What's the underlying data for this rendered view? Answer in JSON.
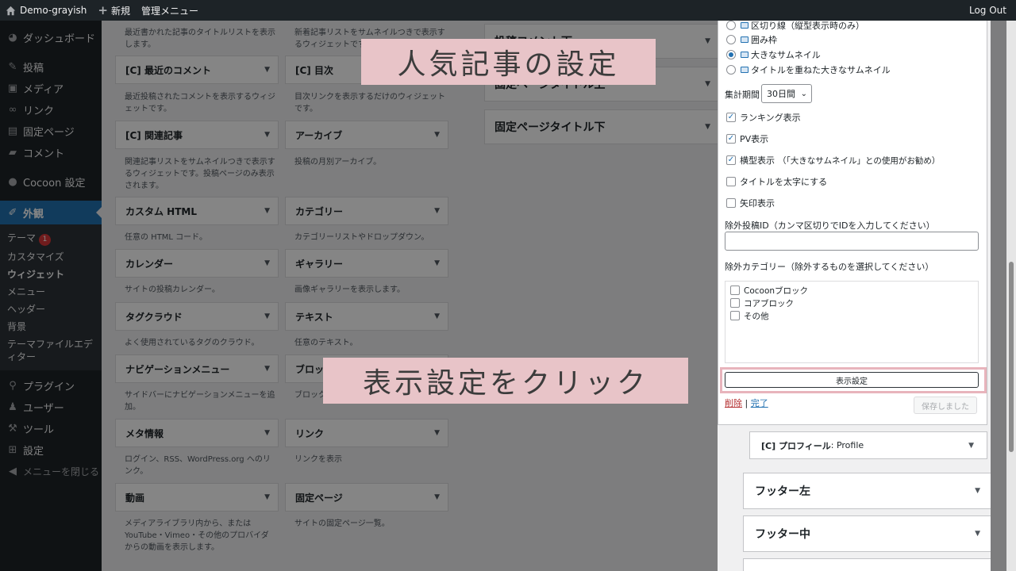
{
  "adminbar": {
    "site_name": "Demo-grayish",
    "new_label": "新規",
    "manage_menu": "管理メニュー",
    "logout": "Log Out"
  },
  "sidebar": {
    "items": [
      {
        "icon": "dashboard-icon",
        "label": "ダッシュボード"
      },
      {
        "icon": "pin-icon",
        "label": "投稿"
      },
      {
        "icon": "media-icon",
        "label": "メディア"
      },
      {
        "icon": "link-icon",
        "label": "リンク"
      },
      {
        "icon": "page-icon",
        "label": "固定ページ"
      },
      {
        "icon": "comment-icon",
        "label": "コメント"
      },
      {
        "icon": "cocoon-icon",
        "label": "Cocoon 設定"
      },
      {
        "icon": "appearance-icon",
        "label": "外観"
      },
      {
        "icon": "plugin-icon",
        "label": "プラグイン"
      },
      {
        "icon": "user-icon",
        "label": "ユーザー"
      },
      {
        "icon": "tool-icon",
        "label": "ツール"
      },
      {
        "icon": "settings-icon",
        "label": "設定"
      },
      {
        "icon": "collapse-icon",
        "label": "メニューを閉じる"
      }
    ],
    "submenu": [
      {
        "label": "テーマ",
        "badge": "1"
      },
      {
        "label": "カスタマイズ"
      },
      {
        "label": "ウィジェット"
      },
      {
        "label": "メニュー"
      },
      {
        "label": "ヘッダー"
      },
      {
        "label": "背景"
      },
      {
        "label": "テーマファイルエディター"
      }
    ]
  },
  "widgets": {
    "top_desc_left": "最近書かれた記事のタイトルリストを表示します。",
    "top_desc_right": "新着記事リストをサムネイルつきで表示するウィジェットです。",
    "rows": [
      {
        "left": {
          "title": "[C] 最近のコメント",
          "desc": "最近投稿されたコメントを表示するウィジェットです。"
        },
        "right": {
          "title": "[C] 目次",
          "desc": "目次リンクを表示するだけのウィジェットです。"
        }
      },
      {
        "left": {
          "title": "[C] 関連記事",
          "desc": "関連記事リストをサムネイルつきで表示するウィジェットです。投稿ページのみ表示されます。"
        },
        "right": {
          "title": "アーカイブ",
          "desc": "投稿の月別アーカイブ。"
        }
      },
      {
        "left": {
          "title": "カスタム HTML",
          "desc": "任意の HTML コード。"
        },
        "right": {
          "title": "カテゴリー",
          "desc": "カテゴリーリストやドロップダウン。"
        }
      },
      {
        "left": {
          "title": "カレンダー",
          "desc": "サイトの投稿カレンダー。"
        },
        "right": {
          "title": "ギャラリー",
          "desc": "画像ギャラリーを表示します。"
        }
      },
      {
        "left": {
          "title": "タグクラウド",
          "desc": "よく使用されているタグのクラウド。"
        },
        "right": {
          "title": "テキスト",
          "desc": "任意のテキスト。"
        }
      },
      {
        "left": {
          "title": "ナビゲーションメニュー",
          "desc": "サイドバーにナビゲーションメニューを追加。"
        },
        "right": {
          "title": "ブロック",
          "desc": "ブロックを"
        }
      },
      {
        "left": {
          "title": "メタ情報",
          "desc": "ログイン、RSS、WordPress.org へのリンク。"
        },
        "right": {
          "title": "リンク",
          "desc": "リンクを表示"
        }
      },
      {
        "left": {
          "title": "動画",
          "desc": "メディアライブラリ内から、または YouTube・Vimeo・その他のプロバイダからの動画を表示します。"
        },
        "right": {
          "title": "固定ページ",
          "desc": "サイトの固定ページ一覧。"
        }
      }
    ]
  },
  "areas": [
    {
      "title": "投稿コメント下"
    },
    {
      "title": "固定ページタイトル上"
    },
    {
      "title": "固定ページタイトル下"
    }
  ],
  "form": {
    "radios": [
      {
        "label": "区切り線（縦型表示時のみ）",
        "checked": false
      },
      {
        "label": "囲み枠",
        "checked": false
      },
      {
        "label": "大きなサムネイル",
        "checked": true
      },
      {
        "label": "タイトルを重ねた大きなサムネイル",
        "checked": false
      }
    ],
    "period_label": "集計期間",
    "period_value": "30日間",
    "checkboxes": [
      {
        "label": "ランキング表示",
        "checked": true
      },
      {
        "label": "PV表示",
        "checked": true
      },
      {
        "label": "横型表示",
        "note": "（「大きなサムネイル」との使用がお勧め）",
        "checked": true
      },
      {
        "label": "タイトルを太字にする",
        "checked": false
      },
      {
        "label": "矢印表示",
        "checked": false
      }
    ],
    "exclude_ids_label": "除外投稿ID（カンマ区切りでIDを入力してください）",
    "exclude_ids_value": "",
    "exclude_cats_label": "除外カテゴリー（除外するものを選択してください）",
    "categories": [
      {
        "label": "Cocoonブロック",
        "checked": false
      },
      {
        "label": "コアブロック",
        "checked": false
      },
      {
        "label": "その他",
        "checked": false
      }
    ],
    "display_button": "表示設定",
    "delete_link": "削除",
    "separator": "|",
    "done_link": "完了",
    "saved_button": "保存しました"
  },
  "profile_widget": {
    "title": "[C] プロフィール",
    "subtitle": ": Profile"
  },
  "footer_areas": [
    {
      "title": "フッター左"
    },
    {
      "title": "フッター中"
    }
  ],
  "annotations": {
    "top": "人気記事の設定",
    "bottom": "表示設定をクリック"
  },
  "colors": {
    "accent": "#2271b1",
    "admin_bg": "#1d2327",
    "callout_bg": "#e8c4c8",
    "highlight_border": "#e8b4bc"
  }
}
